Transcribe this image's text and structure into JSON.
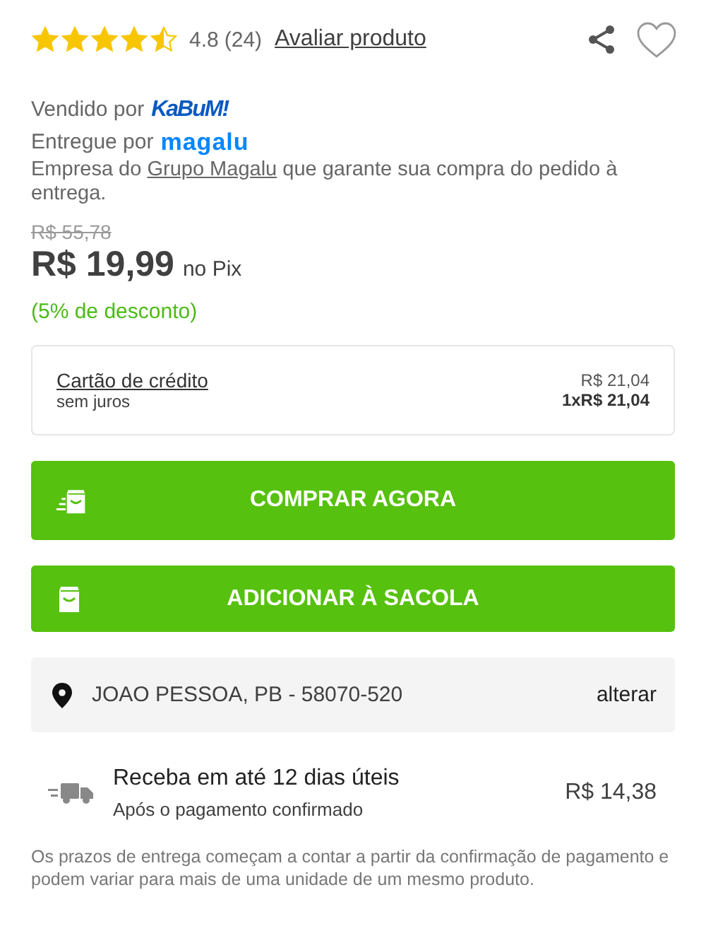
{
  "rating": {
    "stars": 4.5,
    "score": "4.8",
    "count": "(24)",
    "review_link": "Avaliar produto"
  },
  "seller": {
    "sold_by_label": "Vendido por",
    "sold_by_logo": "KaBuM!",
    "delivered_by_label": "Entregue por",
    "delivered_by_logo": "magalu",
    "note_before": "Empresa do ",
    "note_link": "Grupo Magalu",
    "note_after": " que garante sua compra do pedido à entrega."
  },
  "price": {
    "old": "R$ 55,78",
    "current": "R$ 19,99",
    "method": "no Pix",
    "discount": "(5% de desconto)"
  },
  "payment": {
    "title": "Cartão de crédito",
    "subtitle": "sem juros",
    "total": "R$ 21,04",
    "installments": "1xR$ 21,04"
  },
  "buttons": [
    {
      "kind": "buy",
      "label": "COMPRAR AGORA"
    },
    {
      "kind": "bag",
      "label": "ADICIONAR À SACOLA"
    }
  ],
  "location": {
    "address": "JOAO PESSOA, PB - 58070-520",
    "action": "alterar"
  },
  "delivery": {
    "title": "Receba em até 12 dias úteis",
    "subtitle": "Após o pagamento confirmado",
    "price": "R$ 14,38",
    "note": "Os prazos de entrega começam a contar a partir da confirmação de pagamento e podem variar para mais de uma unidade de um mesmo produto."
  }
}
